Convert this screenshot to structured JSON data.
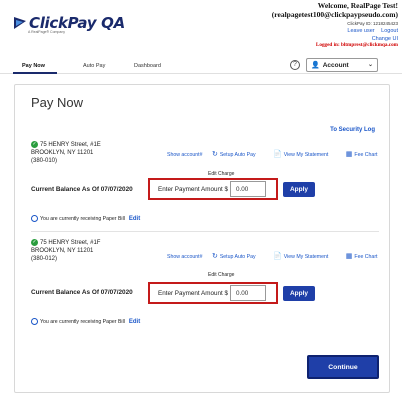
{
  "brand": {
    "name": "ClickPay QA",
    "subtitle": "A RealPage® Company",
    "color": "#1a2a6c"
  },
  "header": {
    "welcome": "Welcome, RealPage Test!",
    "email": "(realpagetest100@clickpaypseudo.com)",
    "clickpay_id": "ClickPay ID: 1218245423",
    "leave_user": "Leave user",
    "logout": "Logout",
    "change_ui": "Change UI",
    "logged_in": "Logged in: bltmprest@clickmqa.com"
  },
  "nav": {
    "tabs": [
      {
        "label": "Pay Now",
        "active": true
      },
      {
        "label": "Auto Pay",
        "active": false
      },
      {
        "label": "Dashboard",
        "active": false
      }
    ],
    "help_icon": "?",
    "account_label": "Account"
  },
  "main": {
    "title": "Pay Now",
    "security_log": "To Security Log",
    "links": {
      "show_account": "Show account#",
      "setup_autopay": "Setup Auto Pay",
      "view_statement": "View My Statement",
      "fee_chart": "Fee Chart"
    },
    "edit_charge": "Edit Charge",
    "pay_label": "Enter Payment Amount $",
    "apply": "Apply",
    "paper_bill": "You are currently receiving Paper Bill",
    "edit": "Edit",
    "properties": [
      {
        "line1": "75 HENRY Street, #1E",
        "line2": "BROOKLYN, NY 11201",
        "line3": "(380-010)",
        "balance_label": "Current Balance As Of 07/07/2020",
        "amount": "0.00"
      },
      {
        "line1": "75 HENRY Street, #1F",
        "line2": "BROOKLYN, NY 11201",
        "line3": "(380-012)",
        "balance_label": "Current Balance As Of 07/07/2020",
        "amount": "0.00"
      }
    ],
    "continue": "Continue"
  },
  "colors": {
    "primary_button": "#1f3fa8",
    "highlight_border": "#c41a1a",
    "link": "#1a56c8",
    "status_ok": "#2a9d3e"
  }
}
